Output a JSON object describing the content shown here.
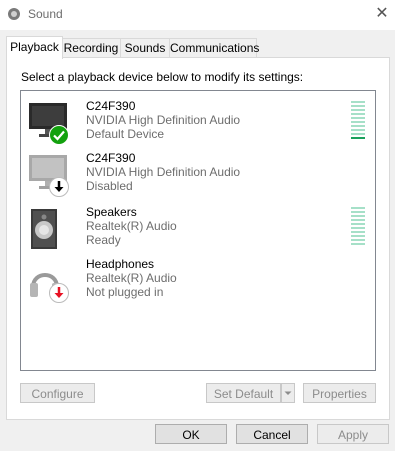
{
  "window": {
    "title": "Sound"
  },
  "tabs": [
    {
      "label": "Playback",
      "active": true
    },
    {
      "label": "Recording"
    },
    {
      "label": "Sounds"
    },
    {
      "label": "Communications"
    }
  ],
  "instruction": "Select a playback device below to modify its settings:",
  "devices": [
    {
      "name": "C24F390",
      "driver": "NVIDIA High Definition Audio",
      "status": "Default Device",
      "icon": "monitor-icon",
      "badge": "check-badge-icon",
      "badge_color": "#13a10e",
      "meter": "yes"
    },
    {
      "name": "C24F390",
      "driver": "NVIDIA High Definition Audio",
      "status": "Disabled",
      "icon": "monitor-icon",
      "badge": "down-arrow-badge-icon",
      "badge_color": "#000000",
      "meter": "no"
    },
    {
      "name": "Speakers",
      "driver": "Realtek(R) Audio",
      "status": "Ready",
      "icon": "speaker-icon",
      "meter": "yes"
    },
    {
      "name": "Headphones",
      "driver": "Realtek(R) Audio",
      "status": "Not plugged in",
      "icon": "headphones-icon",
      "badge": "down-arrow-badge-icon",
      "badge_color": "#e81123",
      "meter": "no"
    }
  ],
  "panel_buttons": {
    "configure": "Configure",
    "set_default": "Set Default",
    "properties": "Properties"
  },
  "dialog_buttons": {
    "ok": "OK",
    "cancel": "Cancel",
    "apply": "Apply"
  },
  "colors": {
    "accent_meter": "#19a05c",
    "meter_idle": "#a6e0c8"
  }
}
